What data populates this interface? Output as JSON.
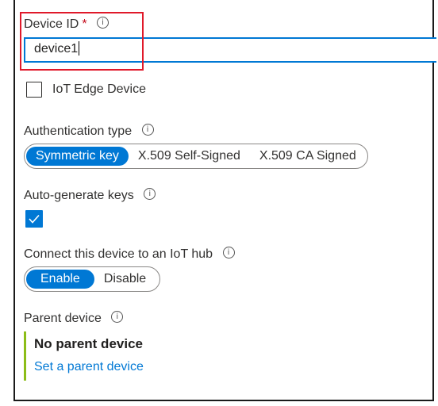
{
  "device_id": {
    "label": "Device ID",
    "required_marker": "*",
    "info_icon": "info-icon",
    "value": "device1"
  },
  "iot_edge": {
    "label": "IoT Edge Device",
    "checked": false
  },
  "auth_type": {
    "label": "Authentication type",
    "info_icon": "info-icon",
    "options": [
      "Symmetric key",
      "X.509 Self-Signed",
      "X.509 CA Signed"
    ],
    "selected": "Symmetric key"
  },
  "auto_generate": {
    "label": "Auto-generate keys",
    "info_icon": "info-icon",
    "checked": true
  },
  "connect": {
    "label": "Connect this device to an IoT hub",
    "info_icon": "info-icon",
    "options": [
      "Enable",
      "Disable"
    ],
    "selected": "Enable"
  },
  "parent": {
    "label": "Parent device",
    "info_icon": "info-icon",
    "value": "No parent device",
    "link": "Set a parent device"
  },
  "colors": {
    "accent": "#0078d4",
    "highlight": "#e0192a",
    "parent_bar": "#8cbd18"
  }
}
